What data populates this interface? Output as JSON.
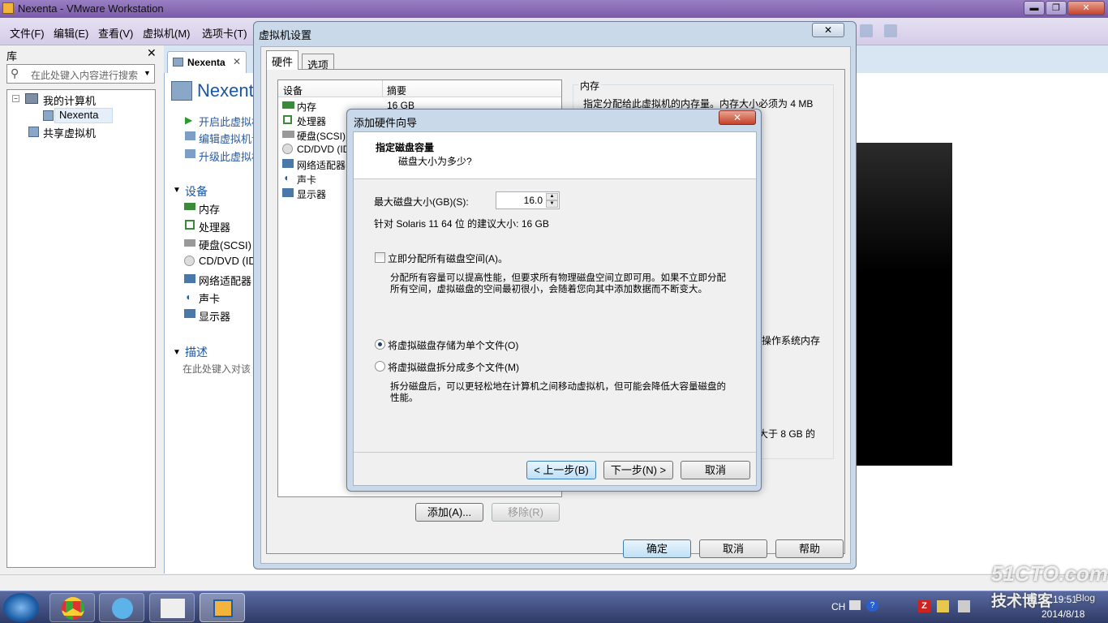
{
  "vmware": {
    "title": "Nexenta - VMware Workstation",
    "win_min": "▬",
    "win_max": "❐",
    "win_close": "✕",
    "menu": [
      "文件(F)",
      "编辑(E)",
      "查看(V)",
      "虚拟机(M)",
      "选项卡(T)"
    ]
  },
  "library": {
    "title": "库",
    "close": "✕",
    "search_placeholder": "在此处键入内容进行搜索",
    "tree": {
      "my_computer": "我的计算机",
      "vm": "Nexenta",
      "shared": "共享虚拟机"
    }
  },
  "tab": {
    "label": "Nexenta",
    "close": "✕"
  },
  "vm_page": {
    "title": "Nexent",
    "actions": [
      "开启此虚拟机",
      "编辑虚拟机设",
      "升级此虚拟机"
    ],
    "devices_heading": "设备",
    "devices": [
      "内存",
      "处理器",
      "硬盘(SCSI)",
      "CD/DVD (ID",
      "网络适配器",
      "声卡",
      "显示器"
    ],
    "desc_heading": "描述",
    "desc_placeholder": "在此处键入对该"
  },
  "settings": {
    "title": "虚拟机设置",
    "close": "✕",
    "tabs": [
      "硬件",
      "选项"
    ],
    "col_device": "设备",
    "col_summary": "摘要",
    "devices": [
      {
        "name": "内存",
        "summary": "16 GB"
      },
      {
        "name": "处理器",
        "summary": ""
      },
      {
        "name": "硬盘(SCSI)",
        "summary": ""
      },
      {
        "name": "CD/DVD (ID",
        "summary": ""
      },
      {
        "name": "网络适配器",
        "summary": ""
      },
      {
        "name": "声卡",
        "summary": ""
      },
      {
        "name": "显示器",
        "summary": ""
      }
    ],
    "memory_group": "内存",
    "memory_desc": "指定分配给此虚拟机的内存量。内存大小必须为 4 MB",
    "memory_frag1": "操作系统内存",
    "memory_frag2": "大于 8 GB 的",
    "add_button": "添加(A)...",
    "remove_button": "移除(R)",
    "ok_button": "确定",
    "cancel_button": "取消",
    "help_button": "帮助"
  },
  "wizard": {
    "title": "添加硬件向导",
    "close": "✕",
    "heading": "指定磁盘容量",
    "subheading": "磁盘大小为多少?",
    "max_size_label": "最大磁盘大小(GB)(S):",
    "max_size_value": "16.0",
    "recommend": "针对 Solaris 11 64 位 的建议大小: 16 GB",
    "alloc_label": "立即分配所有磁盘空间(A)。",
    "alloc_checked": false,
    "alloc_desc1": "分配所有容量可以提高性能，但要求所有物理磁盘空间立即可用。如果不立即分配",
    "alloc_desc2": "所有空间，虚拟磁盘的空间最初很小，会随着您向其中添加数据而不断变大。",
    "single_file": "将虚拟磁盘存储为单个文件(O)",
    "multi_file": "将虚拟磁盘拆分成多个文件(M)",
    "multi_desc1": "拆分磁盘后，可以更轻松地在计算机之间移动虚拟机，但可能会降低大容量磁盘的",
    "multi_desc2": "性能。",
    "back_button": "< 上一步(B)",
    "next_button": "下一步(N) >",
    "cancel_button": "取消"
  },
  "taskbar": {
    "lang": "CH",
    "time": "19:51",
    "date": "2014/8/18"
  },
  "watermark": {
    "site": "51CTO.com",
    "sub": "技术博客",
    "blog": "Blog"
  }
}
